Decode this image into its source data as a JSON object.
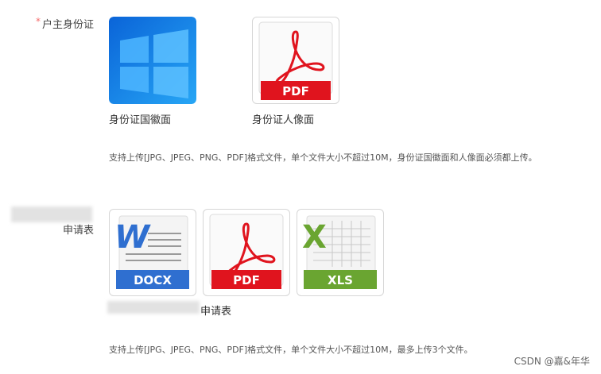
{
  "section1": {
    "required_mark": "*",
    "label": "户主身份证",
    "uploads": [
      {
        "caption": "身份证国徽面",
        "icon": "windows-logo-icon"
      },
      {
        "caption": "身份证人像面",
        "icon": "pdf-file-icon",
        "badge": "PDF"
      }
    ],
    "hint": "支持上传[JPG、JPEG、PNG、PDF]格式文件，单个文件大小不超过10M，身份证国徽面和人像面必须都上传。"
  },
  "section2": {
    "label_visible": "申请表",
    "files": [
      {
        "icon": "docx-file-icon",
        "badge": "DOCX",
        "letter": "W"
      },
      {
        "icon": "pdf-file-icon",
        "badge": "PDF"
      },
      {
        "icon": "xls-file-icon",
        "badge": "XLS",
        "letter": "X"
      }
    ],
    "caption_visible": "申请表",
    "hint": "支持上传[JPG、JPEG、PNG、PDF]格式文件，单个文件大小不超过10M，最多上传3个文件。"
  },
  "watermark": "CSDN @嘉&年华",
  "colors": {
    "required": "#f56c6c",
    "windows_blue": "#1a8ae8",
    "pdf_red": "#e0141e",
    "docx_blue": "#2f6fd0",
    "xls_green": "#6aa531"
  }
}
